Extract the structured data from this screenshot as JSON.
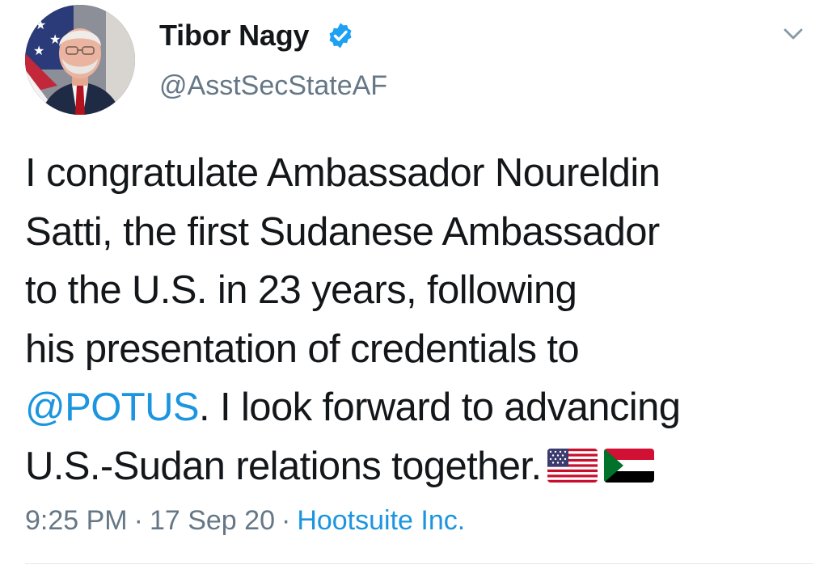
{
  "author": {
    "display_name": "Tibor Nagy",
    "handle": "@AsstSecStateAF",
    "verified": true,
    "avatar_icon": "profile-photo"
  },
  "menu": {
    "icon": "chevron-down-icon"
  },
  "tweet": {
    "lines": [
      "I congratulate Ambassador Noureldin",
      "Satti, the first Sudanese Ambassador",
      "to the U.S. in 23 years, following",
      "his presentation of credentials to",
      ". I look forward to advancing",
      "U.S.-Sudan relations together."
    ],
    "mention": "@POTUS",
    "emoji": [
      "us-flag",
      "sudan-flag"
    ]
  },
  "meta": {
    "time": "9:25 PM",
    "separator": "·",
    "date": "17 Sep 20",
    "source": "Hootsuite Inc."
  },
  "colors": {
    "link": "#1b95e0",
    "secondary_text": "#657786",
    "primary_text": "#14171a",
    "verified_badge": "#1da1f2"
  }
}
